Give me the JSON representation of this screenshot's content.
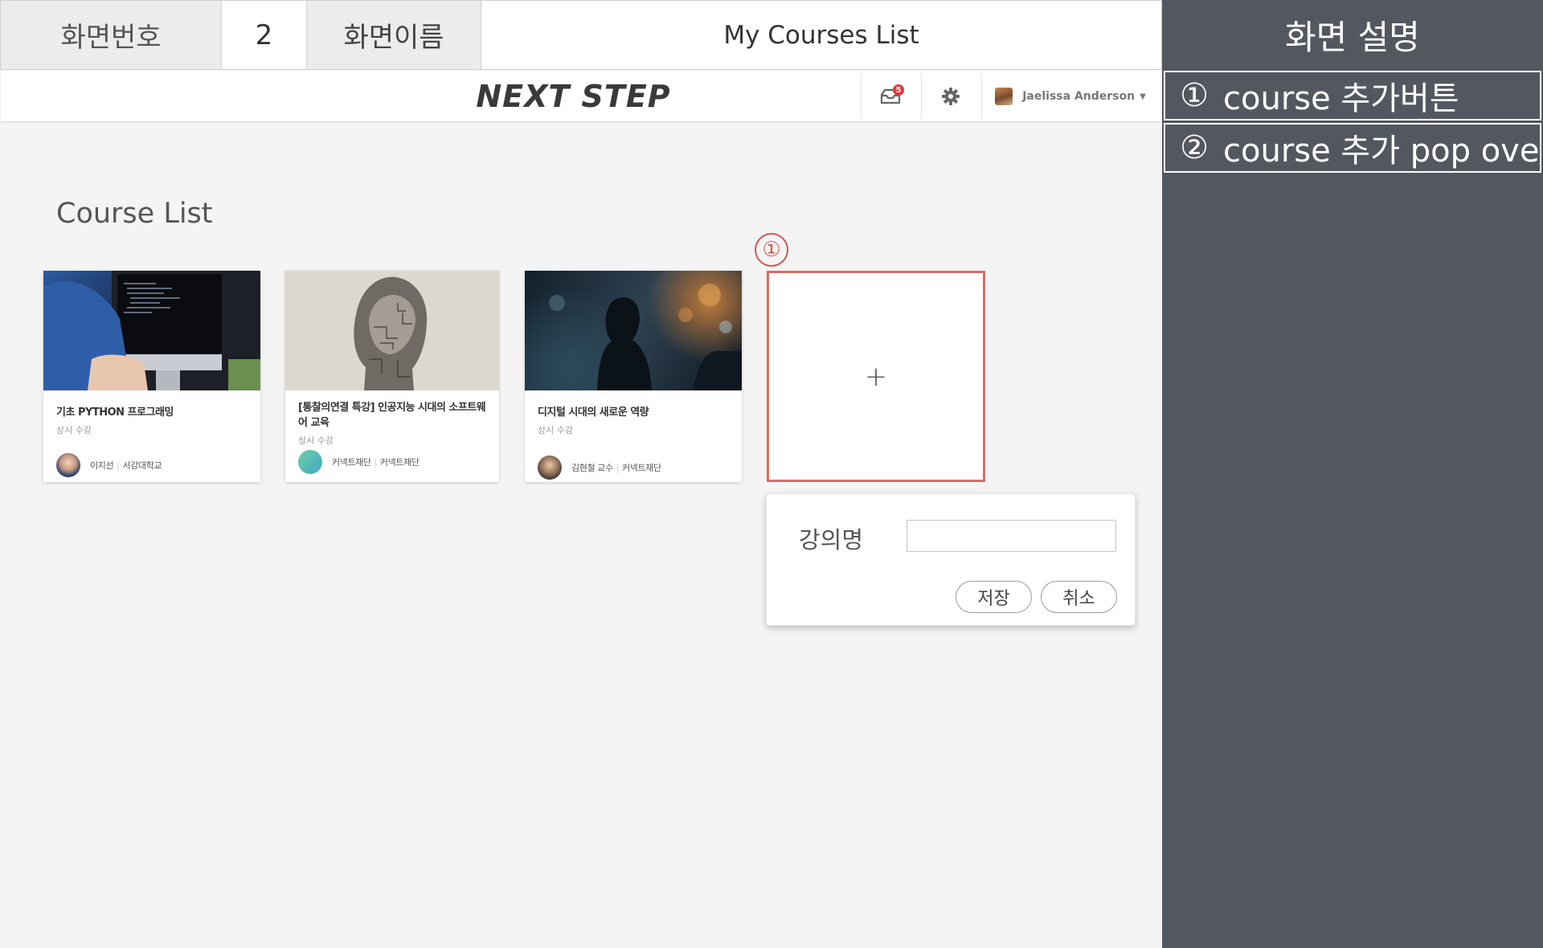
{
  "storyboard": {
    "screen_number_label": "화면번호",
    "screen_number": "2",
    "screen_name_label": "화면이름",
    "screen_name": "My Courses List"
  },
  "description": {
    "title": "화면 설명",
    "items": [
      {
        "num": "①",
        "text": "course 추가버튼"
      },
      {
        "num": "②",
        "text": "course 추가 pop over"
      }
    ]
  },
  "navbar": {
    "logo": "NEXT STEP",
    "notification_count": "5",
    "user_name": "Jaelissa Anderson"
  },
  "page": {
    "title": "Course List",
    "add_marker": "①",
    "add_icon": "+"
  },
  "courses": [
    {
      "title": "기초 PYTHON 프로그래밍",
      "subtitle": "상시 수강",
      "author": "이지선",
      "org": "서강대학교"
    },
    {
      "title": "[통찰의연결 특강] 인공지능 시대의 소프트웨어 교육",
      "subtitle": "상시 수강",
      "author": "커넥트재단",
      "org": "커넥트재단"
    },
    {
      "title": "디지털 시대의 새로운 역량",
      "subtitle": "상시 수강",
      "author": "김현철 교수",
      "org": "커넥트재단"
    }
  ],
  "popover": {
    "label": "강의명",
    "input_value": "",
    "input_placeholder": "",
    "save_label": "저장",
    "cancel_label": "취소"
  },
  "colors": {
    "accent_red": "#d86c67",
    "panel_bg": "#535860",
    "page_bg": "#f4f4f5",
    "badge": "#e03a3a"
  }
}
